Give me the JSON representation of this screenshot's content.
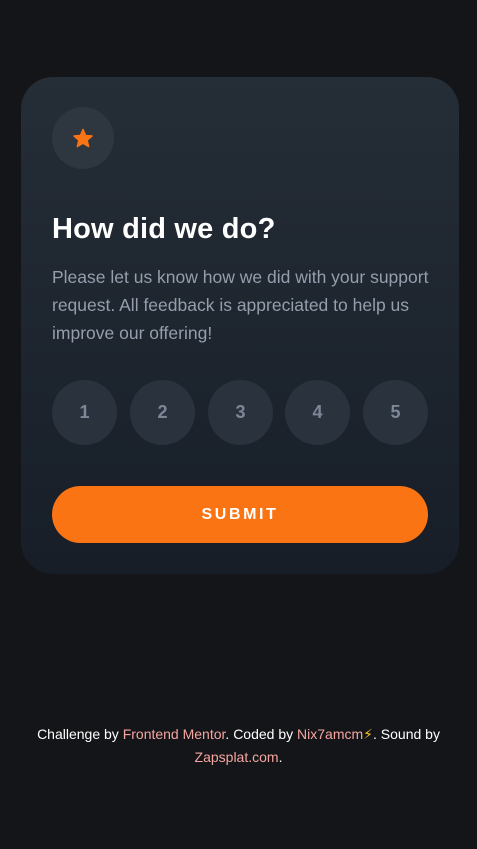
{
  "card": {
    "icon": "star-icon",
    "title": "How did we do?",
    "description": "Please let us know how we did with your support request. All feedback is appreciated to help us improve our offering!",
    "ratings": [
      "1",
      "2",
      "3",
      "4",
      "5"
    ],
    "submit_label": "SUBMIT"
  },
  "footer": {
    "prefix": "Challenge by ",
    "challenge_link": "Frontend Mentor",
    "coded_by": ". Coded by ",
    "author_link": "Nix7amcm",
    "bolt_icon": "lightning-icon",
    "bolt": "⚡",
    "sound_by": ". Sound by",
    "sound_link": "Zapsplat.com",
    "suffix": "."
  },
  "colors": {
    "background": "#131518",
    "card_top": "#252d37",
    "card_bottom": "#171e28",
    "accent": "#fb7413",
    "text_muted": "#959eac",
    "rating_bg": "#2a323d",
    "link": "#f6a5a0"
  }
}
